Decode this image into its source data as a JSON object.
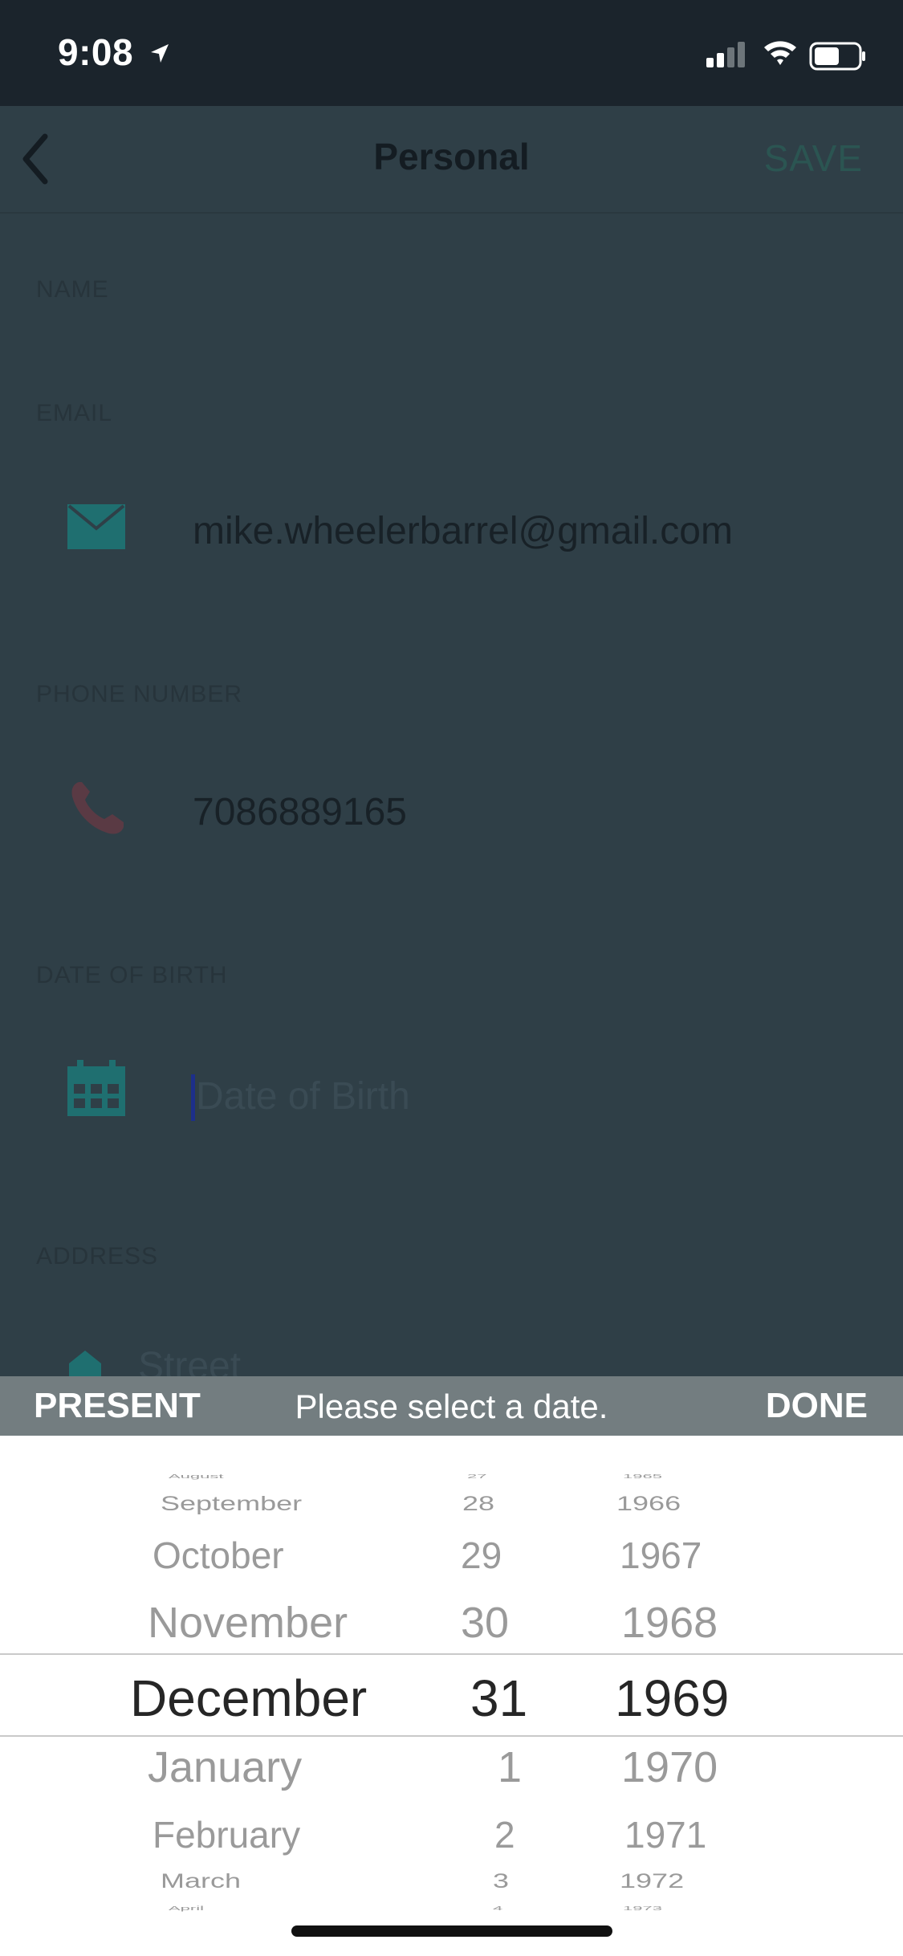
{
  "status_bar": {
    "time": "9:08"
  },
  "nav": {
    "title": "Personal",
    "save_label": "SAVE"
  },
  "form": {
    "name_label": "NAME",
    "email_label": "EMAIL",
    "email_value": "mike.wheelerbarrel@gmail.com",
    "phone_label": "PHONE NUMBER",
    "phone_value": "7086889165",
    "dob_label": "DATE OF BIRTH",
    "dob_placeholder": "Date of Birth",
    "address_label": "ADDRESS",
    "street_placeholder": "Street"
  },
  "toolbar": {
    "present_label": "PRESENT",
    "prompt": "Please select a date.",
    "done_label": "DONE"
  },
  "picker": {
    "months": [
      "August",
      "September",
      "October",
      "November",
      "December",
      "January",
      "February",
      "March",
      "April"
    ],
    "days": [
      "27",
      "28",
      "29",
      "30",
      "31",
      "1",
      "2",
      "3",
      "4"
    ],
    "years": [
      "1965",
      "1966",
      "1967",
      "1968",
      "1969",
      "1970",
      "1971",
      "1972",
      "1973"
    ],
    "selected": {
      "month": "December",
      "day": "31",
      "year": "1969"
    }
  },
  "colors": {
    "accent": "#2b5552",
    "icon_teal": "#1f6f70",
    "phone_icon": "#5a3a44",
    "overlay_bg": "#2f3f47"
  }
}
